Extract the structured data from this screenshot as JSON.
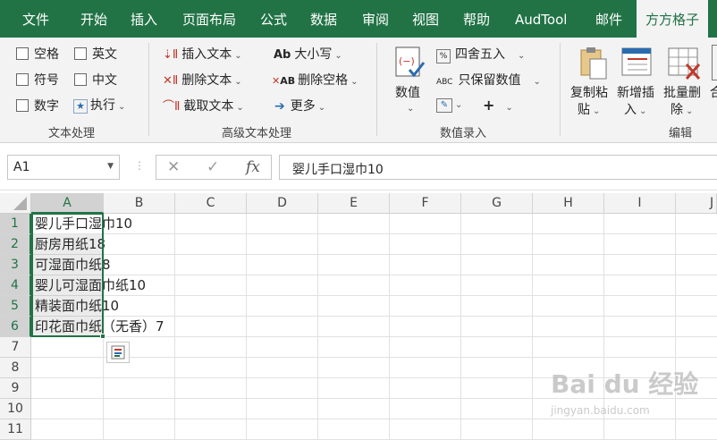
{
  "tabs": [
    "文件",
    "开始",
    "插入",
    "页面布局",
    "公式",
    "数据",
    "审阅",
    "视图",
    "帮助",
    "AudTool",
    "邮件",
    "方方格子"
  ],
  "active_tab": "方方格子",
  "ribbon": {
    "text_group": {
      "checkboxes": [
        "空格",
        "英文",
        "符号",
        "中文",
        "数字"
      ],
      "execute": "执行",
      "label": "文本处理"
    },
    "advanced_group": {
      "insert_text": "插入文本",
      "delete_text": "删除文本",
      "extract_text": "截取文本",
      "case": "大小写",
      "delete_space": "删除空格",
      "more": "更多",
      "label": "高级文本处理"
    },
    "number_group": {
      "value": "数值",
      "round": "四舍五入",
      "keep_value": "只保留数值",
      "label": "数值录入"
    },
    "edit_group": {
      "copy_paste": [
        "复制粘",
        "贴"
      ],
      "add_insert": [
        "新增插",
        "入"
      ],
      "batch_delete": [
        "批量删",
        "除"
      ],
      "more_cut": "合",
      "label": "编辑"
    }
  },
  "formula_bar": {
    "name_box": "A1",
    "cancel": "✕",
    "enter": "✓",
    "fx": "fx",
    "content": "婴儿手口湿巾10"
  },
  "grid": {
    "columns": [
      "A",
      "B",
      "C",
      "D",
      "E",
      "F",
      "G",
      "H",
      "I",
      "J"
    ],
    "rows": [
      "1",
      "2",
      "3",
      "4",
      "5",
      "6",
      "7",
      "8",
      "9",
      "10",
      "11"
    ],
    "cells": [
      "婴儿手口湿巾10",
      "厨房用纸18",
      "可湿面巾纸8",
      "婴儿可湿面巾纸10",
      "精装面巾纸10",
      "印花面巾纸（无香）7"
    ]
  },
  "watermark": {
    "main": "Bai du 经验",
    "sub": "jingyan.baidu.com"
  },
  "icons": {
    "name_box_dropdown": "chevron-down-icon",
    "quick_analysis": "quick-analysis-icon"
  }
}
